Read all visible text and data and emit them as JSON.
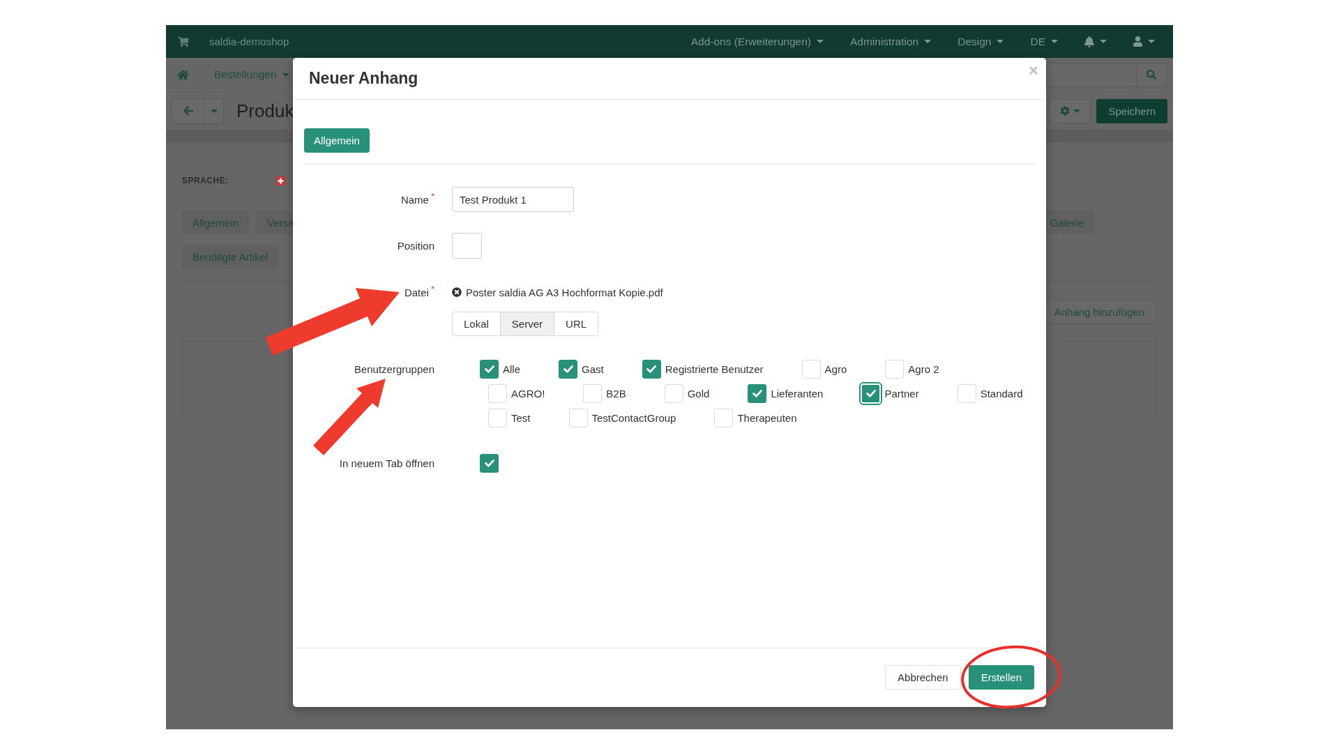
{
  "navbar": {
    "shop_name": "saldia-demoshop",
    "menus": [
      "Add-ons (Erweiterungen)",
      "Administration",
      "Design",
      "DE"
    ]
  },
  "subnav": {
    "menu": "Bestellungen"
  },
  "toolbar": {
    "title": "Produk",
    "save_button": "Speichern"
  },
  "language_label": "SPRACHE:",
  "page_tab_rows": [
    {
      "left": [
        {
          "label": "Allgemein",
          "selected": false
        },
        {
          "label": "Versa",
          "selected": false
        }
      ],
      "right": [
        {
          "label": "Galerie",
          "selected": false
        }
      ]
    },
    {
      "left": [
        {
          "label": "Benötigte Artikel",
          "selected": false
        }
      ],
      "right": []
    }
  ],
  "add_attachment_button": "Anhang hinzufügen",
  "dialog": {
    "title": "Neuer Anhang",
    "tabs": [
      {
        "label": "Allgemein",
        "selected": true
      }
    ],
    "required_mark": "*",
    "form": [
      {
        "kind": "text",
        "label": "Name",
        "required": true,
        "value": "Test Produkt 1"
      },
      {
        "kind": "number",
        "label": "Position",
        "required": false
      },
      {
        "kind": "file",
        "label": "Datei",
        "required": true,
        "filename": "Poster saldia AG A3 Hochformat Kopie.pdf",
        "sources": [
          {
            "label": "Lokal",
            "selected": false
          },
          {
            "label": "Server",
            "selected": true
          },
          {
            "label": "URL",
            "selected": false
          }
        ]
      },
      {
        "kind": "checkbox_group",
        "label": "Benutzergruppen",
        "required": false,
        "groups": [
          {
            "label": "Alle",
            "checked": true,
            "focused": false
          },
          {
            "label": "Gast",
            "checked": true,
            "focused": false
          },
          {
            "label": "Registrierte Benutzer",
            "checked": true,
            "focused": false
          },
          {
            "label": "Agro",
            "checked": false,
            "focused": false
          },
          {
            "label": "Agro 2",
            "checked": false,
            "focused": false
          },
          {
            "label": "AGRO!",
            "checked": false,
            "focused": false
          },
          {
            "label": "B2B",
            "checked": false,
            "focused": false
          },
          {
            "label": "Gold",
            "checked": false,
            "focused": false
          },
          {
            "label": "Lieferanten",
            "checked": true,
            "focused": false
          },
          {
            "label": "Partner",
            "checked": true,
            "focused": true
          },
          {
            "label": "Standard",
            "checked": false,
            "focused": false
          },
          {
            "label": "Test",
            "checked": false,
            "focused": false
          },
          {
            "label": "TestContactGroup",
            "checked": false,
            "focused": false
          },
          {
            "label": "Therapeuten",
            "checked": false,
            "focused": false
          }
        ]
      },
      {
        "kind": "checkbox",
        "label": "In neuem Tab öffnen",
        "required": false,
        "checked": true
      }
    ],
    "buttons": [
      {
        "kind": "secondary",
        "label": "Abbrechen"
      },
      {
        "kind": "primary",
        "label": "Erstellen"
      }
    ]
  }
}
